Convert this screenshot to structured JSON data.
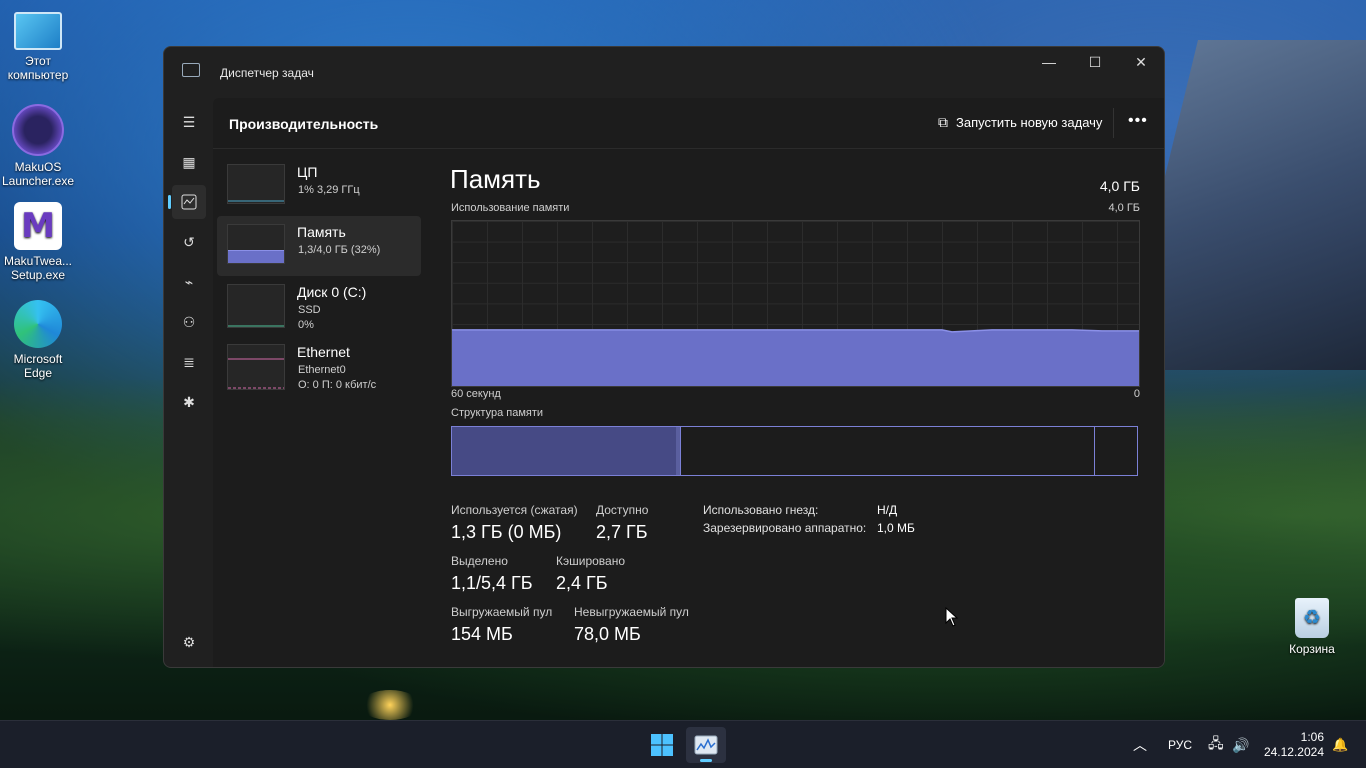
{
  "desktop": {
    "icons": [
      {
        "label": "Этот компьютер",
        "icon": "monitor-icon"
      },
      {
        "label": "MakuOS Launcher.exe",
        "icon": "makuos-logo-icon"
      },
      {
        "label": "MakuTwea... Setup.exe",
        "icon": "makutweaker-logo-icon"
      },
      {
        "label": "Microsoft Edge",
        "icon": "edge-icon"
      },
      {
        "label": "Корзина",
        "icon": "recycle-bin-icon"
      }
    ]
  },
  "window": {
    "title": "Диспетчер задач",
    "controls": {
      "minimize": "—",
      "maximize": "☐",
      "close": "✕"
    }
  },
  "header": {
    "title": "Производительность",
    "run_task": "Запустить новую задачу",
    "more": "•••"
  },
  "nav": [
    "hamburger-icon",
    "processes-icon",
    "performance-icon",
    "app-history-icon",
    "startup-apps-icon",
    "users-icon",
    "details-icon",
    "services-icon",
    "settings-icon"
  ],
  "resources": [
    {
      "name": "ЦП",
      "sub1": "1% 3,29 ГГц",
      "sub2": "",
      "sub3": ""
    },
    {
      "name": "Память",
      "sub1": "1,3/4,0 ГБ (32%)",
      "sub2": "",
      "sub3": ""
    },
    {
      "name": "Диск 0 (C:)",
      "sub1": "SSD",
      "sub2": "0%",
      "sub3": ""
    },
    {
      "name": "Ethernet",
      "sub1": "Ethernet0",
      "sub2": "О: 0 П: 0 кбит/с",
      "sub3": ""
    }
  ],
  "memory": {
    "title": "Память",
    "total": "4,0 ГБ",
    "graph_label": "Использование памяти",
    "graph_max": "4,0 ГБ",
    "time_left": "60 секунд",
    "time_right": "0",
    "usage_fraction": 0.34,
    "structure_label": "Структура памяти",
    "stats": {
      "in_use_label": "Используется (сжатая)",
      "in_use_value": "1,3 ГБ (0 МБ)",
      "available_label": "Доступно",
      "available_value": "2,7 ГБ",
      "committed_label": "Выделено",
      "committed_value": "1,1/5,4 ГБ",
      "cached_label": "Кэшировано",
      "cached_value": "2,4 ГБ",
      "paged_label": "Выгружаемый пул",
      "paged_value": "154 МБ",
      "nonpaged_label": "Невыгружаемый пул",
      "nonpaged_value": "78,0 МБ"
    },
    "kv": {
      "slots_label": "Использовано гнезд:",
      "slots_value": "Н/Д",
      "reserved_label": "Зарезервировано аппаратно:",
      "reserved_value": "1,0 МБ"
    }
  },
  "taskbar": {
    "lang": "РУС",
    "time": "1:06",
    "date": "24.12.2024",
    "accent": "#60cdff"
  },
  "colors": {
    "memory_fill": "#6a70c8",
    "memory_line": "#8b90e8",
    "ethernet_line": "#d36aa8",
    "disk_line": "#4fc39a",
    "cpu_line": "#4aa6c8"
  }
}
